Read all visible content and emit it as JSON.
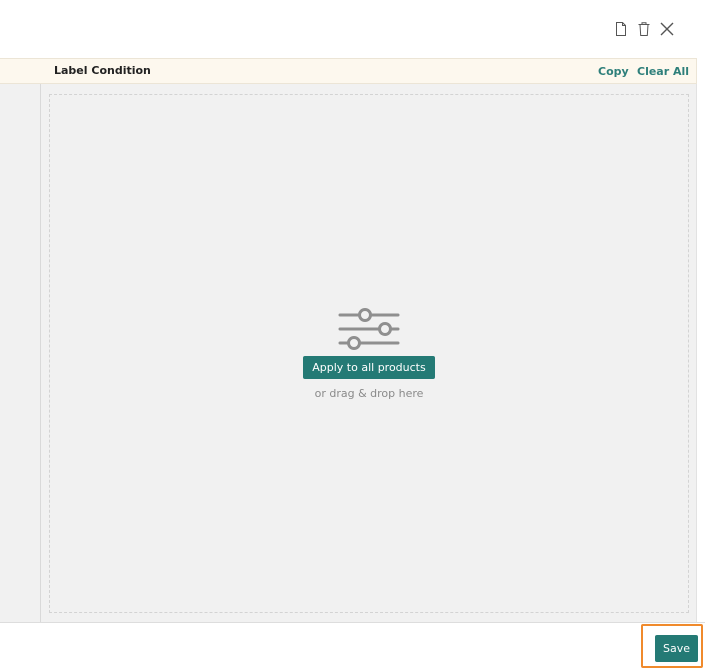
{
  "toolbar": {
    "icons": [
      "document-icon",
      "trash-icon",
      "close-icon"
    ]
  },
  "header": {
    "title": "Label Condition",
    "copy_label": "Copy",
    "clear_all_label": "Clear All"
  },
  "dropzone": {
    "icon": "filter-sliders-icon",
    "apply_button_label": "Apply to all products",
    "hint": "or drag & drop here"
  },
  "footer": {
    "save_label": "Save"
  },
  "colors": {
    "accent": "#247a75",
    "link": "#2e7f7a",
    "header_bg": "#fdf8ee",
    "panel_bg": "#f1f1f1",
    "highlight": "#f08a2c"
  }
}
